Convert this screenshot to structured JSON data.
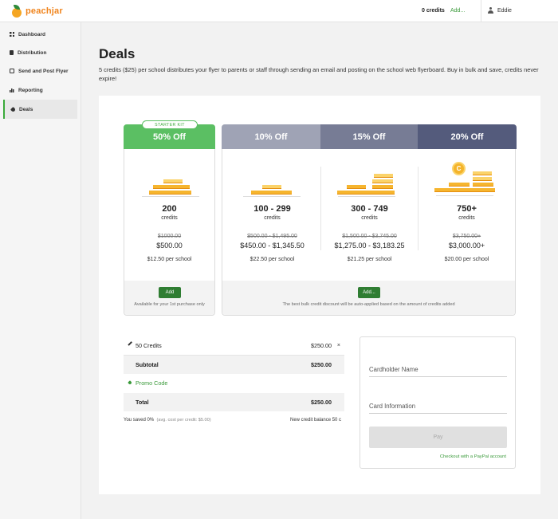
{
  "header": {
    "logo_text": "peachjar",
    "credits": "0 credits",
    "add_link": "Add...",
    "user_name": "Eddie"
  },
  "sidebar": {
    "items": [
      {
        "label": "Dashboard",
        "icon": "grid-icon"
      },
      {
        "label": "Distribution",
        "icon": "document-icon"
      },
      {
        "label": "Send and Post Flyer",
        "icon": "send-icon"
      },
      {
        "label": "Reporting",
        "icon": "bar-chart-icon"
      },
      {
        "label": "Deals",
        "icon": "tag-icon"
      }
    ],
    "active": "Deals"
  },
  "main": {
    "title": "Deals",
    "description": "5 credits ($25) per school distributes your flyer to parents or staff through sending an email and posting on the school web flyerboard. Buy in bulk and save, credits never expire!"
  },
  "starter": {
    "badge": "STARTER KIT",
    "discount": "50% Off",
    "count": "200",
    "unit": "credits",
    "original": "$1000.00",
    "price": "$500.00",
    "per_school": "$12.50 per school",
    "add_label": "Add",
    "note": "Available for your 1st purchase only",
    "header_color": "#5bbf63"
  },
  "bulk": {
    "tiers": [
      {
        "discount": "10% Off",
        "count": "100 - 299",
        "unit": "credits",
        "original": "$500.00 - $1,495.00",
        "price": "$450.00 - $1,345.50",
        "per_school": "$22.50 per school",
        "header_color": "#9fa3b5"
      },
      {
        "discount": "15% Off",
        "count": "300 - 749",
        "unit": "credits",
        "original": "$1,500.00 - $3,745.00",
        "price": "$1,275.00 - $3,183.25",
        "per_school": "$21.25 per school",
        "header_color": "#777c95"
      },
      {
        "discount": "20% Off",
        "count": "750+",
        "unit": "credits",
        "original": "$3,750.00+",
        "price": "$3,000.00+",
        "per_school": "$20.00 per school",
        "header_color": "#545b7c"
      }
    ],
    "coin_label": "C",
    "add_label": "Add...",
    "note": "The best bulk credit discount will be auto-applied based on the amount of credits added"
  },
  "cart": {
    "item_label": "50 Credits",
    "item_value": "$250.00",
    "remove": "×",
    "subtotal_label": "Subtotal",
    "subtotal_value": "$250.00",
    "promo_label": "Promo Code",
    "total_label": "Total",
    "total_value": "$250.00",
    "saved": "You saved 0%",
    "avg_cost": "(avg. cost per credit: $5.00)",
    "balance": "New credit balance 50 c"
  },
  "payment": {
    "cardholder_placeholder": "Cardholder Name",
    "card_info_placeholder": "Card Information",
    "pay_label": "Pay",
    "paypal_link": "Checkout with a PayPal account"
  },
  "colors": {
    "accent_green": "#3aaa3a",
    "button_green": "#2f7d32",
    "coin_gold": "#f6b52e"
  }
}
